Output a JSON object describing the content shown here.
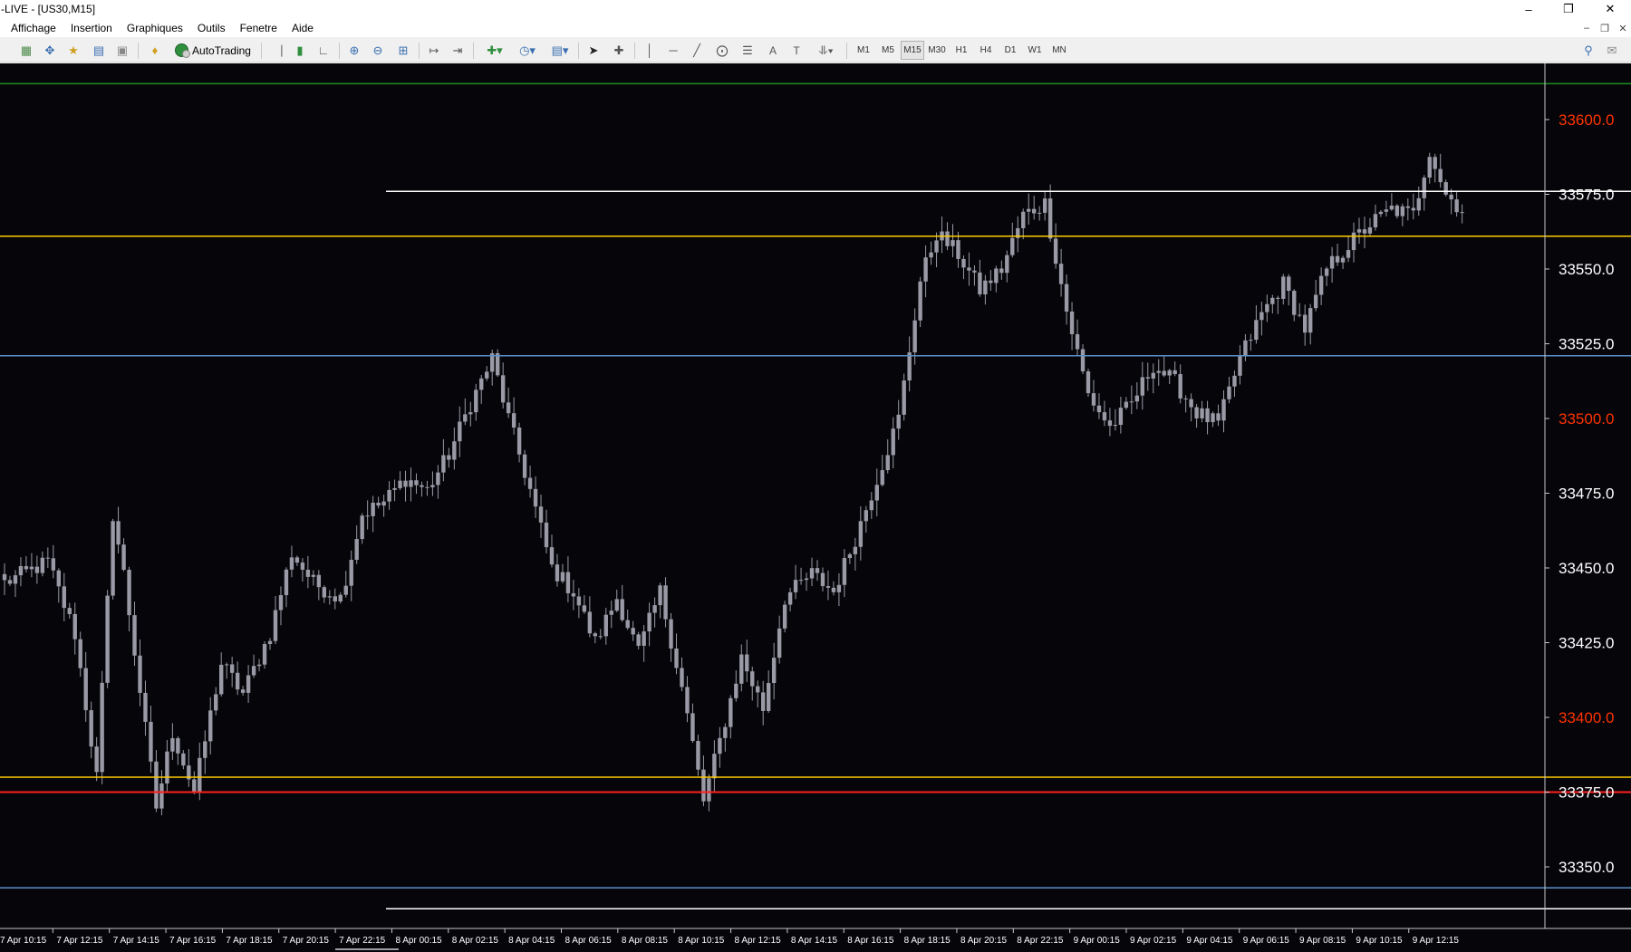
{
  "window": {
    "title": "-LIVE - [US30,M15]",
    "controls": {
      "minimize": "–",
      "restore": "❐",
      "close": "✕"
    },
    "mdi_controls": {
      "minimize": "–",
      "restore": "❐",
      "close": "✕"
    }
  },
  "menu": {
    "items": [
      "Affichage",
      "Insertion",
      "Graphiques",
      "Outils",
      "Fenetre",
      "Aide"
    ]
  },
  "toolbar": {
    "autotrading_label": "AutoTrading",
    "timeframes": [
      "M1",
      "M5",
      "M15",
      "M30",
      "H1",
      "H4",
      "D1",
      "W1",
      "MN"
    ],
    "active_timeframe": "M15",
    "text_tool": "A",
    "text_label_tool": "T"
  },
  "chart": {
    "symbol": "US30",
    "timeframe": "M15",
    "colors": {
      "background": "#05050a",
      "candle": "#9a9aa6",
      "axis_text": "#ffffff",
      "alert_price_text": "#ff3300",
      "line_green": "#1f8f1f",
      "line_white": "#ffffff",
      "line_yellow": "#ffcc00",
      "line_blue": "#5a8fc8",
      "line_red": "#ff2020"
    },
    "price_axis": [
      {
        "label": "33600.0",
        "value": 33600,
        "alert": true
      },
      {
        "label": "33575.0",
        "value": 33575,
        "alert": false
      },
      {
        "label": "33550.0",
        "value": 33550,
        "alert": false
      },
      {
        "label": "33525.0",
        "value": 33525,
        "alert": false
      },
      {
        "label": "33500.0",
        "value": 33500,
        "alert": true
      },
      {
        "label": "33475.0",
        "value": 33475,
        "alert": false
      },
      {
        "label": "33450.0",
        "value": 33450,
        "alert": false
      },
      {
        "label": "33425.0",
        "value": 33425,
        "alert": false
      },
      {
        "label": "33400.0",
        "value": 33400,
        "alert": true
      },
      {
        "label": "33375.0",
        "value": 33375,
        "alert": false
      },
      {
        "label": "33350.0",
        "value": 33350,
        "alert": false
      }
    ],
    "time_axis": [
      "7 Apr 10:15",
      "7 Apr 12:15",
      "7 Apr 14:15",
      "7 Apr 16:15",
      "7 Apr 18:15",
      "7 Apr 20:15",
      "7 Apr 22:15",
      "8 Apr 00:15",
      "8 Apr 02:15",
      "8 Apr 04:15",
      "8 Apr 06:15",
      "8 Apr 08:15",
      "8 Apr 10:15",
      "8 Apr 12:15",
      "8 Apr 14:15",
      "8 Apr 16:15",
      "8 Apr 18:15",
      "8 Apr 20:15",
      "8 Apr 22:15",
      "9 Apr 00:15",
      "9 Apr 02:15",
      "9 Apr 04:15",
      "9 Apr 06:15",
      "9 Apr 08:15",
      "9 Apr 10:15",
      "9 Apr 12:15"
    ],
    "horizontal_lines": [
      {
        "name": "green-line",
        "price": 33612,
        "color": "#1f8f1f",
        "partial": false
      },
      {
        "name": "upper-white-line",
        "price": 33576,
        "color": "#ffffff",
        "partial": true
      },
      {
        "name": "upper-yellow-line",
        "price": 33561,
        "color": "#ffcc00",
        "partial": false
      },
      {
        "name": "upper-blue-line",
        "price": 33521,
        "color": "#5a8fc8",
        "partial": false
      },
      {
        "name": "lower-yellow-line",
        "price": 33380,
        "color": "#ffcc00",
        "partial": false
      },
      {
        "name": "red-line",
        "price": 33375,
        "color": "#ff2020",
        "partial": false
      },
      {
        "name": "lower-blue-line",
        "price": 33343,
        "color": "#5a8fc8",
        "partial": false
      },
      {
        "name": "lower-white-line",
        "price": 33336,
        "color": "#ffffff",
        "partial": true
      }
    ],
    "waypoints": [
      [
        0,
        33445
      ],
      [
        8,
        33452
      ],
      [
        13,
        33428
      ],
      [
        17,
        33380
      ],
      [
        20,
        33468
      ],
      [
        22,
        33448
      ],
      [
        28,
        33370
      ],
      [
        31,
        33395
      ],
      [
        35,
        33375
      ],
      [
        40,
        33418
      ],
      [
        44,
        33408
      ],
      [
        49,
        33428
      ],
      [
        53,
        33455
      ],
      [
        57,
        33445
      ],
      [
        62,
        33440
      ],
      [
        66,
        33468
      ],
      [
        70,
        33472
      ],
      [
        74,
        33480
      ],
      [
        78,
        33476
      ],
      [
        82,
        33488
      ],
      [
        86,
        33505
      ],
      [
        90,
        33520
      ],
      [
        93,
        33500
      ],
      [
        97,
        33476
      ],
      [
        101,
        33450
      ],
      [
        105,
        33442
      ],
      [
        109,
        33425
      ],
      [
        113,
        33440
      ],
      [
        117,
        33422
      ],
      [
        121,
        33442
      ],
      [
        125,
        33410
      ],
      [
        129,
        33372
      ],
      [
        132,
        33392
      ],
      [
        136,
        33420
      ],
      [
        140,
        33403
      ],
      [
        144,
        33440
      ],
      [
        149,
        33448
      ],
      [
        153,
        33442
      ],
      [
        157,
        33460
      ],
      [
        161,
        33480
      ],
      [
        165,
        33500
      ],
      [
        169,
        33546
      ],
      [
        172,
        33562
      ],
      [
        176,
        33555
      ],
      [
        180,
        33543
      ],
      [
        184,
        33550
      ],
      [
        188,
        33568
      ],
      [
        192,
        33572
      ],
      [
        196,
        33536
      ],
      [
        200,
        33508
      ],
      [
        204,
        33497
      ],
      [
        208,
        33505
      ],
      [
        212,
        33518
      ],
      [
        216,
        33512
      ],
      [
        220,
        33502
      ],
      [
        224,
        33498
      ],
      [
        228,
        33520
      ],
      [
        232,
        33535
      ],
      [
        236,
        33545
      ],
      [
        240,
        33530
      ],
      [
        244,
        33550
      ],
      [
        248,
        33558
      ],
      [
        252,
        33565
      ],
      [
        256,
        33570
      ],
      [
        260,
        33568
      ],
      [
        263,
        33590
      ],
      [
        266,
        33575
      ],
      [
        269,
        33570
      ]
    ]
  }
}
